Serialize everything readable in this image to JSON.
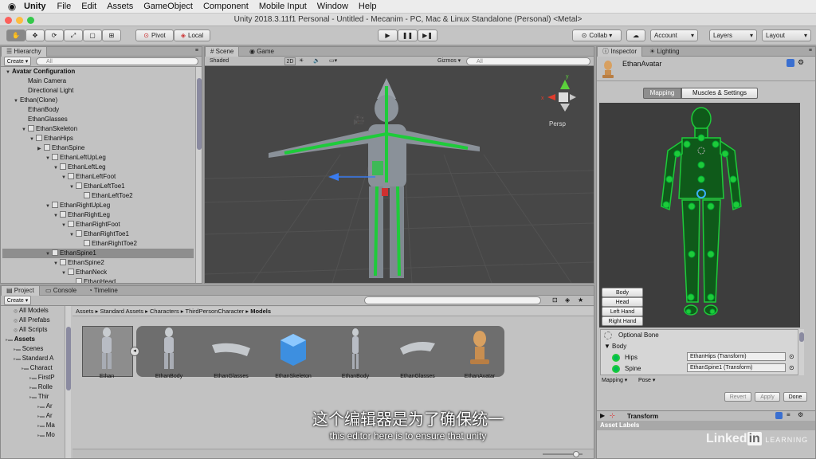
{
  "menubar": {
    "apple": "",
    "app": "Unity",
    "items": [
      "File",
      "Edit",
      "Assets",
      "GameObject",
      "Component",
      "Mobile Input",
      "Window",
      "Help"
    ]
  },
  "window_title": "Unity 2018.3.11f1 Personal - Untitled - Mecanim - PC, Mac & Linux Standalone (Personal) <Metal>",
  "toolbar": {
    "pivot": "Pivot",
    "local": "Local",
    "collab": "Collab ▾",
    "account": "Account",
    "layers": "Layers",
    "layout": "Layout"
  },
  "hierarchy": {
    "tab": "Hierarchy",
    "create": "Create ▾",
    "search_placeholder": "All",
    "rows": [
      {
        "label": "Avatar Configuration",
        "indent": 0,
        "arrow": "▼",
        "bold": true,
        "cube": false
      },
      {
        "label": "Main Camera",
        "indent": 2,
        "arrow": "",
        "cube": false
      },
      {
        "label": "Directional Light",
        "indent": 2,
        "arrow": "",
        "cube": false
      },
      {
        "label": "Ethan(Clone)",
        "indent": 1,
        "arrow": "▼",
        "cube": false
      },
      {
        "label": "EthanBody",
        "indent": 2,
        "arrow": "",
        "cube": false
      },
      {
        "label": "EthanGlasses",
        "indent": 2,
        "arrow": "",
        "cube": false
      },
      {
        "label": "EthanSkeleton",
        "indent": 2,
        "arrow": "▼",
        "cube": true
      },
      {
        "label": "EthanHips",
        "indent": 3,
        "arrow": "▼",
        "cube": true
      },
      {
        "label": "EthanSpine",
        "indent": 4,
        "arrow": "▶",
        "cube": true
      },
      {
        "label": "EthanLeftUpLeg",
        "indent": 5,
        "arrow": "▼",
        "cube": true
      },
      {
        "label": "EthanLeftLeg",
        "indent": 6,
        "arrow": "▼",
        "cube": true
      },
      {
        "label": "EthanLeftFoot",
        "indent": 7,
        "arrow": "▼",
        "cube": true
      },
      {
        "label": "EthanLeftToe1",
        "indent": 8,
        "arrow": "▼",
        "cube": true
      },
      {
        "label": "EthanLeftToe2",
        "indent": 9,
        "arrow": "",
        "cube": true
      },
      {
        "label": "EthanRightUpLeg",
        "indent": 5,
        "arrow": "▼",
        "cube": true
      },
      {
        "label": "EthanRightLeg",
        "indent": 6,
        "arrow": "▼",
        "cube": true
      },
      {
        "label": "EthanRightFoot",
        "indent": 7,
        "arrow": "▼",
        "cube": true
      },
      {
        "label": "EthanRightToe1",
        "indent": 8,
        "arrow": "▼",
        "cube": true
      },
      {
        "label": "EthanRightToe2",
        "indent": 9,
        "arrow": "",
        "cube": true
      },
      {
        "label": "EthanSpine1",
        "indent": 5,
        "arrow": "▼",
        "cube": true,
        "selected": true
      },
      {
        "label": "EthanSpine2",
        "indent": 6,
        "arrow": "▼",
        "cube": true
      },
      {
        "label": "EthanNeck",
        "indent": 7,
        "arrow": "▼",
        "cube": true
      },
      {
        "label": "EthanHead",
        "indent": 8,
        "arrow": "",
        "cube": true
      }
    ]
  },
  "scene": {
    "tab_scene": "Scene",
    "tab_game": "Game",
    "shading": "Shaded",
    "mode_2d": "2D",
    "gizmos": "Gizmos ▾",
    "search_placeholder": "All",
    "persp": "Persp",
    "gizmo_y": "y",
    "gizmo_x": "x"
  },
  "project": {
    "tab_project": "Project",
    "tab_console": "Console",
    "tab_timeline": "Timeline",
    "create": "Create ▾",
    "tree": [
      {
        "label": "All Models",
        "indent": 1
      },
      {
        "label": "All Prefabs",
        "indent": 1
      },
      {
        "label": "All Scripts",
        "indent": 1
      },
      {
        "label": "Assets",
        "indent": 0,
        "bold": true
      },
      {
        "label": "Scenes",
        "indent": 1
      },
      {
        "label": "Standard A",
        "indent": 1
      },
      {
        "label": "Charact",
        "indent": 2
      },
      {
        "label": "FirstP",
        "indent": 3
      },
      {
        "label": "Rolle",
        "indent": 3
      },
      {
        "label": "Thir",
        "indent": 3
      },
      {
        "label": "Ar",
        "indent": 4
      },
      {
        "label": "Ar",
        "indent": 4
      },
      {
        "label": "Ma",
        "indent": 4
      },
      {
        "label": "Mo",
        "indent": 4
      }
    ],
    "breadcrumb": [
      "Assets",
      "Standard Assets",
      "Characters",
      "ThirdPersonCharacter",
      "Models"
    ],
    "assets": [
      "Ethan",
      "EthanBody",
      "EthanGlasses",
      "EthanSkeleton",
      "EthanBody",
      "EthanGlasses",
      "EthanAvatar"
    ]
  },
  "inspector": {
    "tab_inspector": "Inspector",
    "tab_lighting": "Lighting",
    "object_name": "EthanAvatar",
    "tab_mapping": "Mapping",
    "tab_muscles": "Muscles & Settings",
    "view_buttons": [
      "Body",
      "Head",
      "Left Hand",
      "Right Hand"
    ],
    "optional_bone": "Optional Bone",
    "body_section": "Body",
    "bones": [
      {
        "name": "Hips",
        "transform": "EthanHips (Transform)"
      },
      {
        "name": "Spine",
        "transform": "EthanSpine1 (Transform)"
      }
    ],
    "mapping_dropdown": "Mapping ▾",
    "pose_dropdown": "Pose ▾",
    "revert": "Revert",
    "apply": "Apply",
    "done": "Done",
    "transform_label": "Transform",
    "asset_labels": "Asset Labels"
  },
  "subtitles": {
    "chinese": "这个编辑器是为了确保统一",
    "english": "this editor here is to ensure that unity"
  },
  "watermark": {
    "brand": "Linked",
    "in": "in",
    "learning": "LEARNING"
  },
  "colors": {
    "bone_green": "#1ecb3a",
    "selected_row": "#8e8e8e",
    "scene_bg": "#444444",
    "avatar_bg": "#3d3d3d"
  }
}
